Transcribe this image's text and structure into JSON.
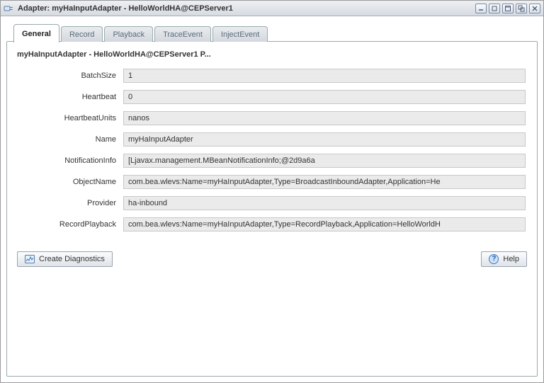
{
  "window": {
    "title": "Adapter: myHaInputAdapter - HelloWorldHA@CEPServer1"
  },
  "tabs": [
    {
      "label": "General",
      "active": true
    },
    {
      "label": "Record",
      "active": false
    },
    {
      "label": "Playback",
      "active": false
    },
    {
      "label": "TraceEvent",
      "active": false
    },
    {
      "label": "InjectEvent",
      "active": false
    }
  ],
  "panel": {
    "heading": "myHaInputAdapter - HelloWorldHA@CEPServer1 P..."
  },
  "properties": [
    {
      "label": "BatchSize",
      "value": "1"
    },
    {
      "label": "Heartbeat",
      "value": "0"
    },
    {
      "label": "HeartbeatUnits",
      "value": "nanos"
    },
    {
      "label": "Name",
      "value": "myHaInputAdapter"
    },
    {
      "label": "NotificationInfo",
      "value": "[Ljavax.management.MBeanNotificationInfo;@2d9a6a"
    },
    {
      "label": "ObjectName",
      "value": "com.bea.wlevs:Name=myHaInputAdapter,Type=BroadcastInboundAdapter,Application=He"
    },
    {
      "label": "Provider",
      "value": "ha-inbound"
    },
    {
      "label": "RecordPlayback",
      "value": "com.bea.wlevs:Name=myHaInputAdapter,Type=RecordPlayback,Application=HelloWorldH"
    }
  ],
  "footer": {
    "createDiagnostics": "Create Diagnostics",
    "help": "Help"
  }
}
